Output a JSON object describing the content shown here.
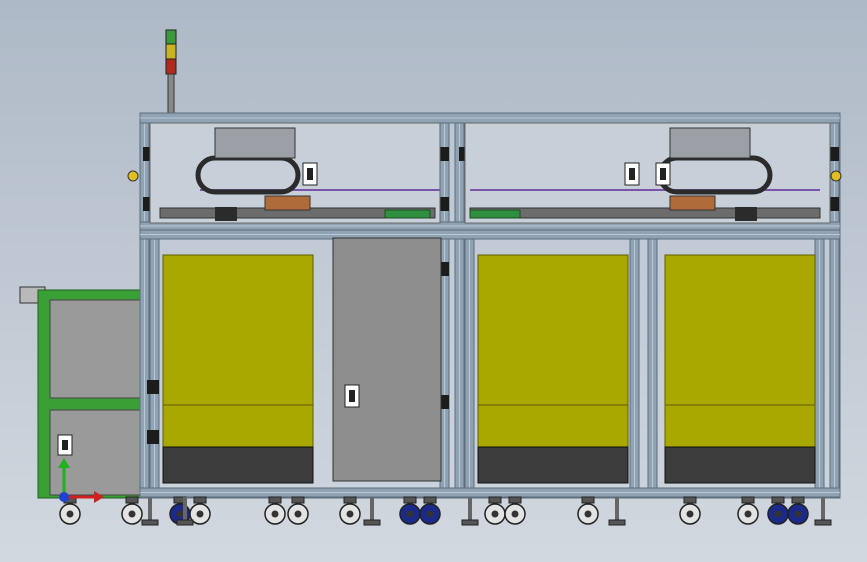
{
  "scene": {
    "kind": "cad-assembly-front-view",
    "background": {
      "top": "#aeb9c7",
      "bottom": "#d2d8df"
    },
    "colors": {
      "frame": "#8fa3b4",
      "frame_dark": "#5d6e7d",
      "panel_yellow": "#a9a800",
      "panel_yellow_edge": "#5e5d00",
      "panel_base": "#3c3c3c",
      "door_grey": "#8d8d8d",
      "side_cabinet_green": "#3aa035",
      "side_cabinet_panel": "#9a9a9a",
      "glass": "#c7d0d8",
      "caster_blue": "#1b2a8a",
      "caster_white": "#e3e3e3",
      "beacon_green": "#3b9b3b",
      "beacon_yellow": "#c8b41e",
      "beacon_red": "#b02a1e"
    },
    "icons": [
      "signal-tower-icon",
      "axis-triad-icon",
      "caster-wheel-icon",
      "door-handle-icon"
    ],
    "axis_triad": {
      "x_color": "#d02020",
      "y_color": "#20b020",
      "z_color": "#2040d0"
    }
  }
}
